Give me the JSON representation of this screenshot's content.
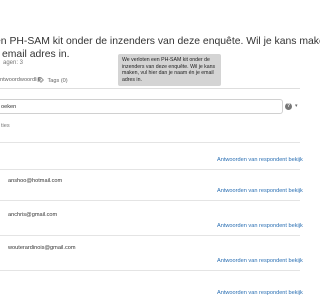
{
  "heading": {
    "line1": "en PH-SAM kit onder de inzenders van deze enquête. Wil je kans maken,",
    "line2": "email adres in."
  },
  "subheading": "agen: 3",
  "tabs": [
    {
      "label": "ntwoordwoordlijk",
      "icon": "list-icon"
    },
    {
      "label": "Tags (0)",
      "icon": "tag-icon"
    }
  ],
  "tooltip": "We verloten een PH-SAM kit onder de inzenders van deze enquête. Wil je kans maken, vul hier dan je naam én je email adres in.",
  "search": {
    "value": "oeken"
  },
  "section_label": "ties",
  "view_link": "Antwoorden van respondent bekijk",
  "emails": [
    "anshoo@hotmail.com",
    "anchris@gmail.com",
    "wouterardinois@gmail.com"
  ],
  "colors": {
    "link": "#2a6fb3",
    "tooltip_bg": "#d4d4d4"
  }
}
